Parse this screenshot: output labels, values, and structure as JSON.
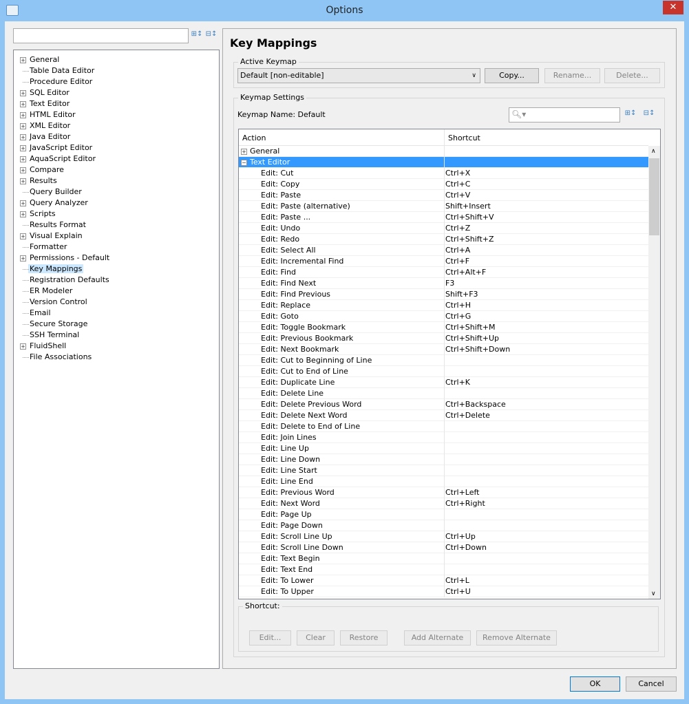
{
  "window": {
    "title": "Options",
    "close": "✕"
  },
  "left": {
    "search_value": "",
    "tree": [
      {
        "label": "General",
        "exp": true
      },
      {
        "label": "Table Data Editor"
      },
      {
        "label": "Procedure Editor"
      },
      {
        "label": "SQL Editor",
        "exp": true
      },
      {
        "label": "Text Editor",
        "exp": true
      },
      {
        "label": "HTML Editor",
        "exp": true
      },
      {
        "label": "XML Editor",
        "exp": true
      },
      {
        "label": "Java Editor",
        "exp": true
      },
      {
        "label": "JavaScript Editor",
        "exp": true
      },
      {
        "label": "AquaScript Editor",
        "exp": true
      },
      {
        "label": "Compare",
        "exp": true
      },
      {
        "label": "Results",
        "exp": true
      },
      {
        "label": "Query Builder"
      },
      {
        "label": "Query Analyzer",
        "exp": true
      },
      {
        "label": "Scripts",
        "exp": true
      },
      {
        "label": "Results Format"
      },
      {
        "label": "Visual Explain",
        "exp": true
      },
      {
        "label": "Formatter"
      },
      {
        "label": "Permissions - Default",
        "exp": true
      },
      {
        "label": "Key Mappings",
        "selected": true
      },
      {
        "label": "Registration Defaults"
      },
      {
        "label": "ER Modeler"
      },
      {
        "label": "Version Control"
      },
      {
        "label": "Email"
      },
      {
        "label": "Secure Storage"
      },
      {
        "label": "SSH Terminal"
      },
      {
        "label": "FluidShell",
        "exp": true
      },
      {
        "label": "File Associations"
      }
    ]
  },
  "main": {
    "title": "Key Mappings",
    "active_keymap": {
      "label": "Active Keymap",
      "selected": "Default [non-editable]",
      "copy": "Copy...",
      "rename": "Rename...",
      "delete": "Delete..."
    },
    "settings": {
      "label": "Keymap Settings",
      "keymap_name": "Keymap Name: Default",
      "search_value": "",
      "columns": [
        "Action",
        "Shortcut"
      ],
      "groups": [
        {
          "label": "General",
          "expanded": false
        },
        {
          "label": "Text Editor",
          "expanded": true,
          "selected": true
        }
      ],
      "rows": [
        [
          "Edit: Cut",
          "Ctrl+X"
        ],
        [
          "Edit: Copy",
          "Ctrl+C"
        ],
        [
          "Edit: Paste",
          "Ctrl+V"
        ],
        [
          "Edit: Paste (alternative)",
          "Shift+Insert"
        ],
        [
          "Edit: Paste ...",
          "Ctrl+Shift+V"
        ],
        [
          "Edit: Undo",
          "Ctrl+Z"
        ],
        [
          "Edit: Redo",
          "Ctrl+Shift+Z"
        ],
        [
          "Edit: Select All",
          "Ctrl+A"
        ],
        [
          "Edit: Incremental Find",
          "Ctrl+F"
        ],
        [
          "Edit: Find",
          "Ctrl+Alt+F"
        ],
        [
          "Edit: Find Next",
          "F3"
        ],
        [
          "Edit: Find Previous",
          "Shift+F3"
        ],
        [
          "Edit: Replace",
          "Ctrl+H"
        ],
        [
          "Edit: Goto",
          "Ctrl+G"
        ],
        [
          "Edit: Toggle Bookmark",
          "Ctrl+Shift+M"
        ],
        [
          "Edit: Previous Bookmark",
          "Ctrl+Shift+Up"
        ],
        [
          "Edit: Next Bookmark",
          "Ctrl+Shift+Down"
        ],
        [
          "Edit: Cut to Beginning of Line",
          ""
        ],
        [
          "Edit: Cut to End of Line",
          ""
        ],
        [
          "Edit: Duplicate Line",
          "Ctrl+K"
        ],
        [
          "Edit: Delete Line",
          ""
        ],
        [
          "Edit: Delete Previous Word",
          "Ctrl+Backspace"
        ],
        [
          "Edit: Delete Next Word",
          "Ctrl+Delete"
        ],
        [
          "Edit: Delete to End of Line",
          ""
        ],
        [
          "Edit: Join Lines",
          ""
        ],
        [
          "Edit: Line Up",
          ""
        ],
        [
          "Edit: Line Down",
          ""
        ],
        [
          "Edit: Line Start",
          ""
        ],
        [
          "Edit: Line End",
          ""
        ],
        [
          "Edit: Previous Word",
          "Ctrl+Left"
        ],
        [
          "Edit: Next Word",
          "Ctrl+Right"
        ],
        [
          "Edit: Page Up",
          ""
        ],
        [
          "Edit: Page Down",
          ""
        ],
        [
          "Edit: Scroll Line Up",
          "Ctrl+Up"
        ],
        [
          "Edit: Scroll Line Down",
          "Ctrl+Down"
        ],
        [
          "Edit: Text Begin",
          ""
        ],
        [
          "Edit: Text End",
          ""
        ],
        [
          "Edit: To Lower",
          "Ctrl+L"
        ],
        [
          "Edit: To Upper",
          "Ctrl+U"
        ]
      ]
    },
    "shortcut": {
      "label": "Shortcut:",
      "edit": "Edit...",
      "clear": "Clear",
      "restore": "Restore",
      "add_alt": "Add Alternate",
      "remove_alt": "Remove Alternate"
    }
  },
  "footer": {
    "ok": "OK",
    "cancel": "Cancel"
  },
  "colors": {
    "selection": "#3399ff",
    "titlebar": "#8ec5f5"
  }
}
